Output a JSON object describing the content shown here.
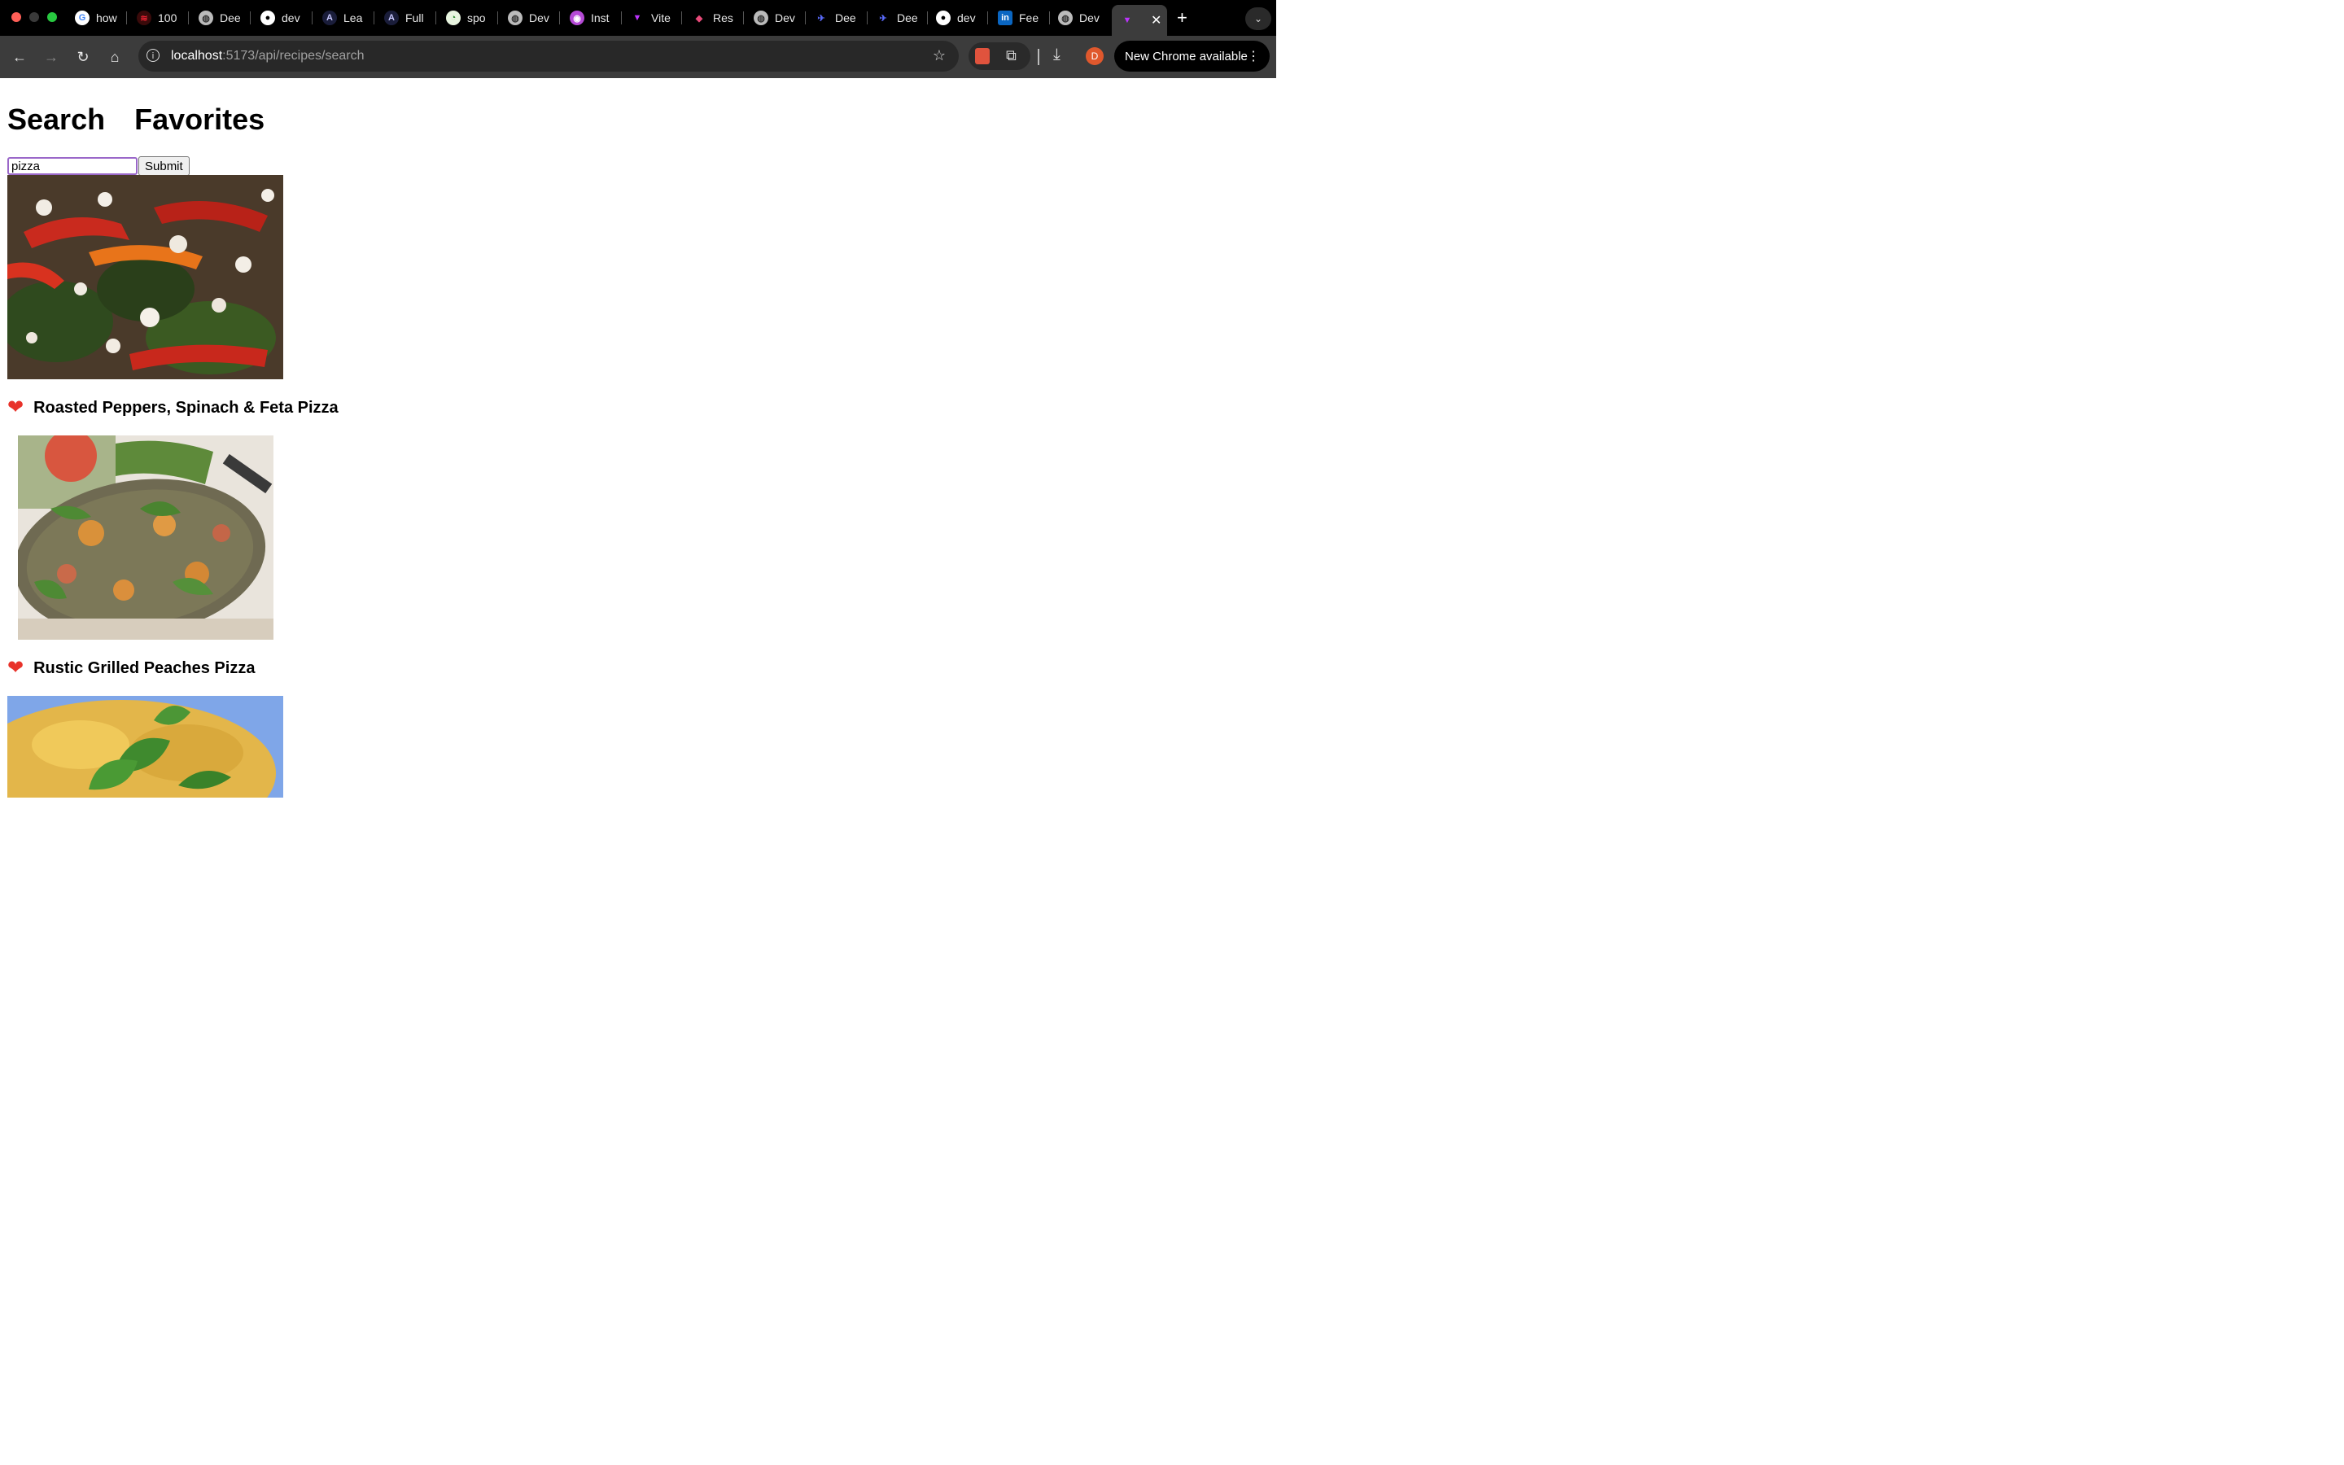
{
  "browser": {
    "tabs": [
      {
        "label": "how",
        "icon": "google-icon"
      },
      {
        "label": "100",
        "icon": "stripes-icon"
      },
      {
        "label": "Dee",
        "icon": "globe-icon"
      },
      {
        "label": "dev",
        "icon": "github-icon"
      },
      {
        "label": "Lea",
        "icon": "angular-icon"
      },
      {
        "label": "Full",
        "icon": "angular-icon"
      },
      {
        "label": "spo",
        "icon": "spotify-icon"
      },
      {
        "label": "Dev",
        "icon": "globe-icon"
      },
      {
        "label": "Inst",
        "icon": "instagram-icon"
      },
      {
        "label": "Vite",
        "icon": "vite-icon"
      },
      {
        "label": "Res",
        "icon": "pin-icon"
      },
      {
        "label": "Dev",
        "icon": "globe-icon"
      },
      {
        "label": "Dee",
        "icon": "feather-icon"
      },
      {
        "label": "Dee",
        "icon": "feather-icon"
      },
      {
        "label": "dev",
        "icon": "github-icon"
      },
      {
        "label": "Fee",
        "icon": "linkedin-icon"
      },
      {
        "label": "Dev",
        "icon": "globe-icon"
      }
    ],
    "url_host": "localhost",
    "url_path": ":5173/api/recipes/search",
    "avatar_letter": "D",
    "update_label": "New Chrome available"
  },
  "nav": {
    "search_label": "Search",
    "favorites_label": "Favorites"
  },
  "search": {
    "value": "pizza",
    "submit_label": "Submit"
  },
  "recipes": [
    {
      "title": "Roasted Peppers, Spinach & Feta Pizza"
    },
    {
      "title": "Rustic Grilled Peaches Pizza"
    },
    {
      "title": ""
    }
  ],
  "colors": {
    "heart": "#e8322a",
    "input_focus": "#9a67c9",
    "tab_strip": "#000000",
    "toolbar": "#3c3c3c"
  }
}
